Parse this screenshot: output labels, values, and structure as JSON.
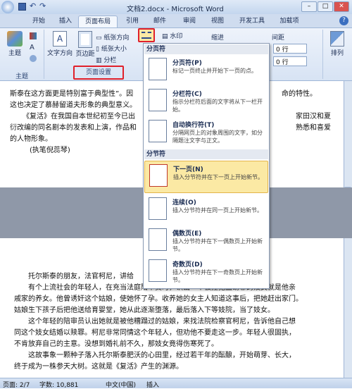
{
  "app": {
    "title": "文档2.docx - Microsoft Word",
    "win_min": "–",
    "win_max": "□",
    "win_close": "✕"
  },
  "tabs": [
    "开始",
    "插入",
    "页面布局",
    "引用",
    "邮件",
    "审阅",
    "视图",
    "开发工具",
    "加载项"
  ],
  "ribbon": {
    "theme_label": "主题",
    "textdir": "文字方向",
    "margins": "页边距",
    "orientation": "纸张方向",
    "size": "纸张大小",
    "columns": "分栏",
    "page_setup_group": "页面设置",
    "theme_group": "主题",
    "watermark": "水印",
    "indent": "缩进",
    "spacing": "间距",
    "spin1": "0 行",
    "spin2": "0 行",
    "arrange": "排列"
  },
  "menu": {
    "section1": "分页符",
    "section2": "分节符",
    "items": [
      {
        "title": "分页符(P)",
        "desc": "标记一页终止并开始下一页的点。"
      },
      {
        "title": "分栏符(C)",
        "desc": "指示分栏符后面的文字将从下一栏开始。"
      },
      {
        "title": "自动换行符(T)",
        "desc": "分隔网页上的对象周围的文字，如分隔题注文字与正文。"
      },
      {
        "title": "下一页(N)",
        "desc": "插入分节符并在下一页上开始新节。"
      },
      {
        "title": "连续(O)",
        "desc": "插入分节符并在同一页上开始新节。"
      },
      {
        "title": "偶数页(E)",
        "desc": "插入分节符并在下一偶数页上开始新节。"
      },
      {
        "title": "奇数页(D)",
        "desc": "插入分节符并在下一奇数页上开始新节。"
      }
    ]
  },
  "doc": {
    "top_lines": [
      "斯泰在这方面更是特别富于典型性”。因",
      "这也决定了慕赫留道夫形象的典型意义。",
      "《复活》在我国自本世纪初至今已出",
      "衍改编的同名剧本的发表和上演，作品和",
      "的人物形象。",
      "(执笔倪蕊琴)"
    ],
    "top_right": [
      "命的特性。",
      "家田汉和夏",
      "熟悉和喜爱"
    ],
    "bottom_lines": [
      "托尔斯泰的朋友，法官柯尼，讲给",
      "有个上流社会的年轻人，在充当法庭陪审员时，认出一个被控犯盗窃罪的妓女就是他亲",
      "戚家的养女。他曾诱奸这个姑娘，使她怀了孕。收养她的女主人知道这事后，把她赶出家门。",
      "姑娘生下孩子后把他送给育婴堂，她从此逐渐堕落，最后落入下等妓院，当了妓女。",
      "这个年轻的陪审员认出她就是被他糟蹋过的姑娘，来找法院检察官柯尼，告诉他自己想",
      "同这个妓女结婚以赎罪。柯尼非常同情这个年轻人，但劝他不要走这一步。年轻人很固执，",
      "不肯放弃自己的主意。没想到婚礼前不久，那妓女竟得伤寒死了。",
      "这故事象一颗种子落入托尔斯泰肥沃的心田里，经过若干年的酝酿，开始萌芽、长大，",
      "终于成为一株参天大树。这就是《复活》产生的渊源。"
    ]
  },
  "status": {
    "page": "页面: 2/7",
    "words": "字数: 10,881",
    "lang": "中文(中国)",
    "mode": "插入"
  }
}
